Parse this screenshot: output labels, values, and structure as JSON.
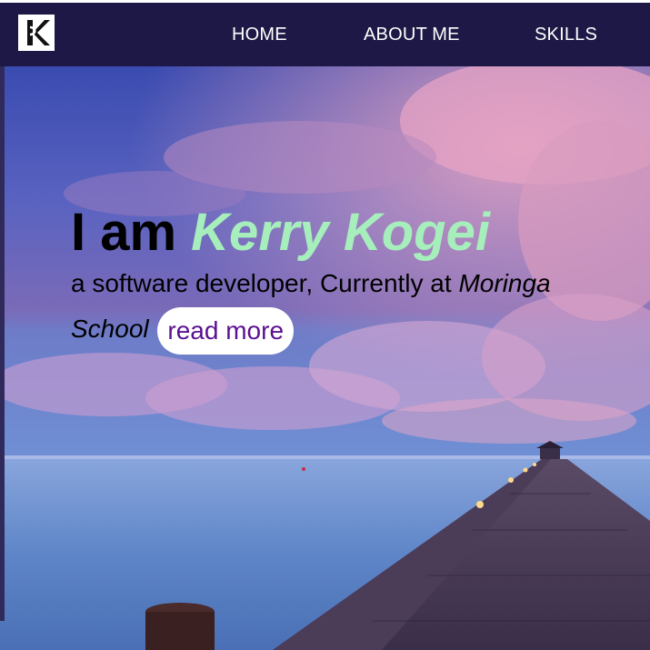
{
  "nav": {
    "logo_letter": "K",
    "links": [
      {
        "label": "HOME"
      },
      {
        "label": "ABOUT ME"
      },
      {
        "label": "SKILLS"
      }
    ]
  },
  "hero": {
    "intro": "I am ",
    "name": "Kerry Kogei",
    "tagline_prefix": "a software developer, Currently at ",
    "school": "Moringa School",
    "read_more_label": "read more",
    "background_description_icon": "sunset-pier-image"
  },
  "colors": {
    "navbar": "#1d1845",
    "name_accent": "#a6eebc",
    "read_more_text": "#5a1190",
    "nav_text": "#ffffff"
  }
}
